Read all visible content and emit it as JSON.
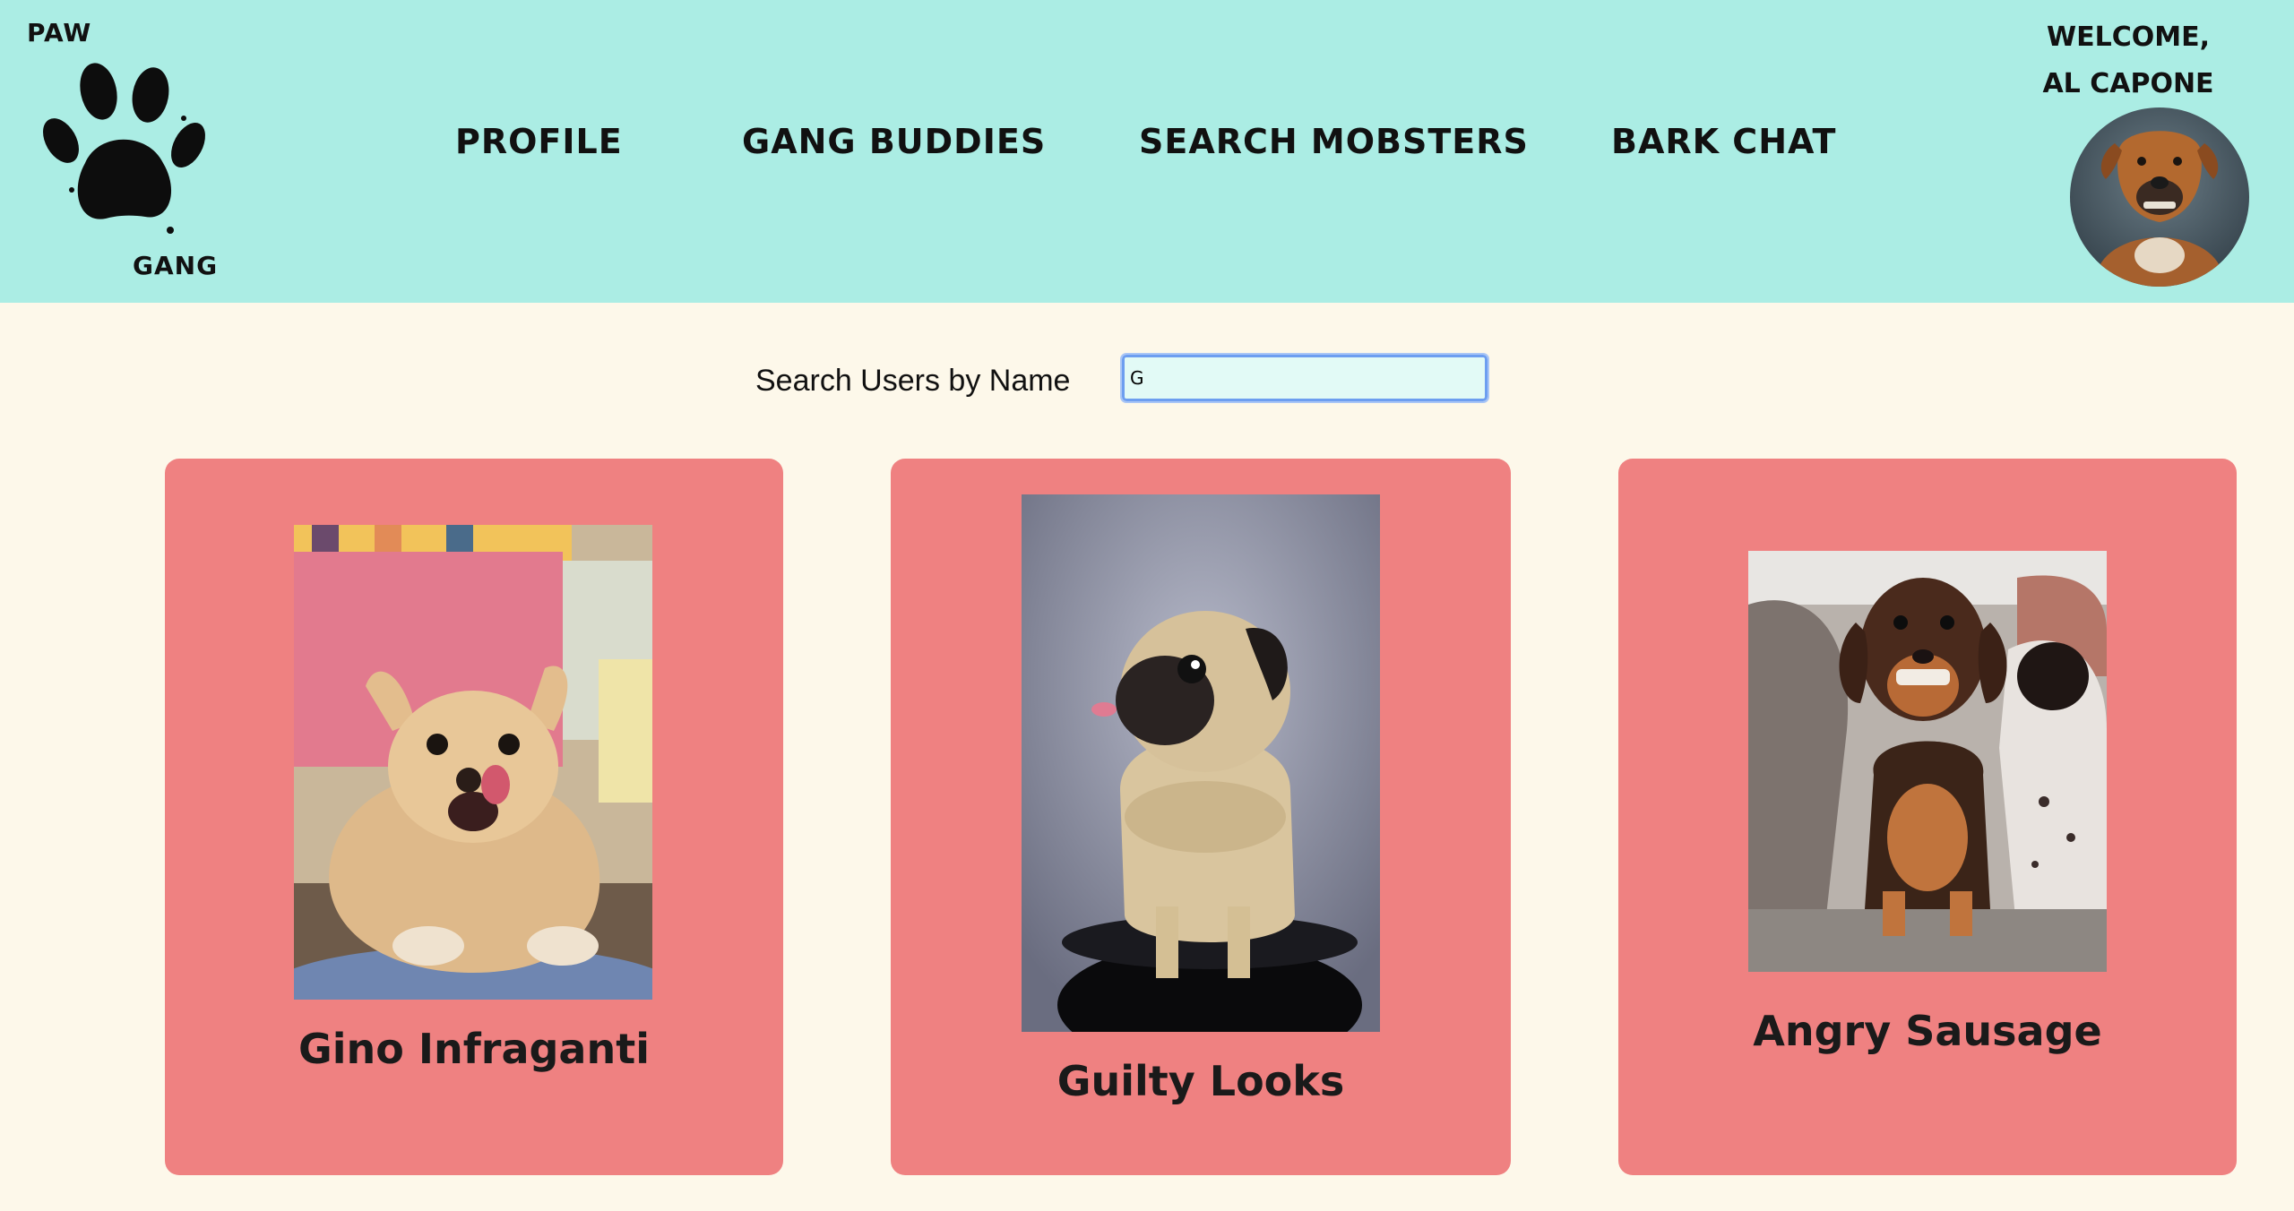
{
  "brand": {
    "top": "PAW",
    "bottom": "GANG",
    "logo_icon": "paw-print-icon"
  },
  "nav": {
    "items": [
      {
        "label": "PROFILE"
      },
      {
        "label": "GANG BUDDIES"
      },
      {
        "label": "SEARCH MOBSTERS"
      },
      {
        "label": "BARK CHAT"
      }
    ]
  },
  "user": {
    "welcome": "WELCOME,",
    "name": "AL CAPONE"
  },
  "search": {
    "label": "Search Users by Name",
    "value": "G"
  },
  "results": [
    {
      "name": "Gino Infraganti",
      "photo": "chihuahua-photo"
    },
    {
      "name": "Guilty Looks",
      "photo": "pug-photo"
    },
    {
      "name": "Angry Sausage",
      "photo": "dachshund-photo"
    }
  ],
  "colors": {
    "header": "#abede4",
    "page": "#fdf8ea",
    "card": "#ef8181",
    "input_border": "#6d9ef0"
  }
}
